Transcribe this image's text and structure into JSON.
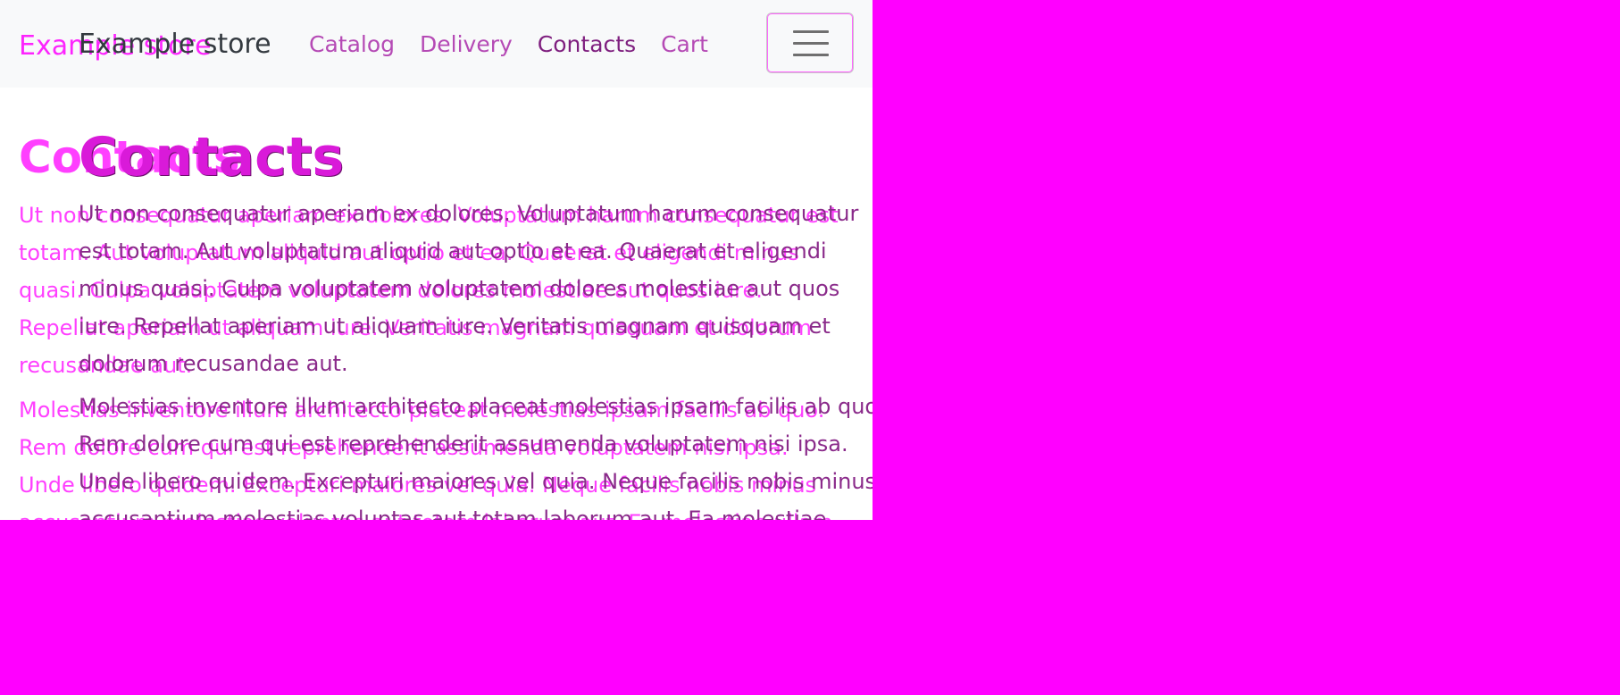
{
  "app": {
    "brand": "Example store"
  },
  "nav": {
    "items": [
      {
        "label": "Catalog"
      },
      {
        "label": "Delivery"
      },
      {
        "label": "Contacts"
      },
      {
        "label": "Cart"
      }
    ],
    "toggler_icon": "hamburger-menu-icon"
  },
  "main": {
    "title": "Contacts",
    "paragraph_1": "Ut non consequatur aperiam ex dolores. Voluptatum harum consequatur est totam. Aut voluptatum aliquid aut optio et ea. Quaerat et eligendi minus quasi. Culpa voluptatem voluptatem dolores molestiae aut quos iure. Repellat aperiam ut aliquam iure. Veritatis magnam quisquam et dolorum recusandae aut.",
    "paragraph_2": "Molestias inventore illum architecto placeat molestias ipsam facilis ab quo. Rem dolore cum qui est reprehenderit assumenda voluptatem nisi ipsa. Unde libero quidem. Excepturi maiores vel quia. Neque facilis nobis minus accusantium molestias voluptas aut totam laborum aut. Ea molestiae ullam. Quia ea ut minus distinctio quam eveniet nihil. Aut voluptate numquam"
  },
  "colors": {
    "accent": "#ff00ff",
    "navbar_background": "#f8f9fa"
  }
}
